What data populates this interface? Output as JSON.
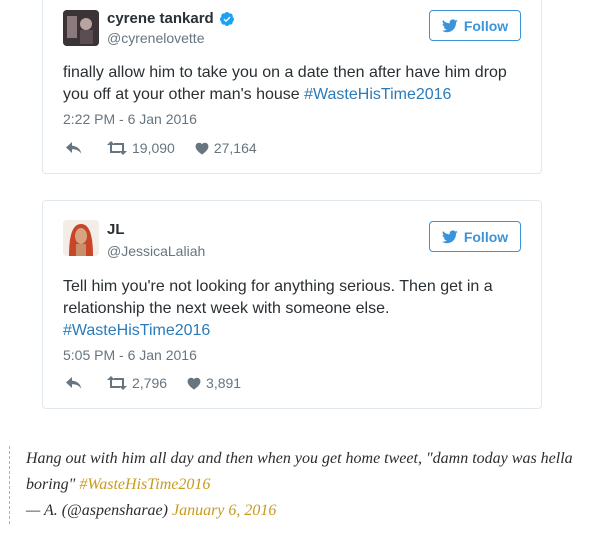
{
  "colors": {
    "twitter_blue": "#3b94d9",
    "hashtag_blue": "#2b7bb9",
    "quote_link_gold": "#c99a1d",
    "verified_blue": "#1da1f2"
  },
  "tweets": [
    {
      "display_name": "cyrene tankard",
      "verified": true,
      "handle": "@cyrenelovette",
      "follow_label": "Follow",
      "text_before": "finally allow him to take you on a date then after have him drop you off at your other man's house ",
      "hashtag": "#WasteHisTime2016",
      "timestamp": "2:22 PM - 6 Jan 2016",
      "retweets": "19,090",
      "likes": "27,164"
    },
    {
      "display_name": "JL",
      "verified": false,
      "handle": "@JessicaLaliah",
      "follow_label": "Follow",
      "text_before": "Tell him you're not looking for anything serious. Then get in a relationship the next week with someone else. ",
      "hashtag": "#WasteHisTime2016",
      "timestamp": "5:05 PM - 6 Jan 2016",
      "retweets": "2,796",
      "likes": "3,891"
    }
  ],
  "quote": {
    "text": "Hang out with him all day and then when you get home tweet, \"damn today was hella boring\" ",
    "hashtag": "#WasteHisTime2016",
    "attribution": "— A. (@aspensharae) ",
    "date": "January 6, 2016"
  },
  "icons": [
    "verified-icon",
    "twitter-bird-icon",
    "reply-icon",
    "retweet-icon",
    "heart-icon"
  ]
}
